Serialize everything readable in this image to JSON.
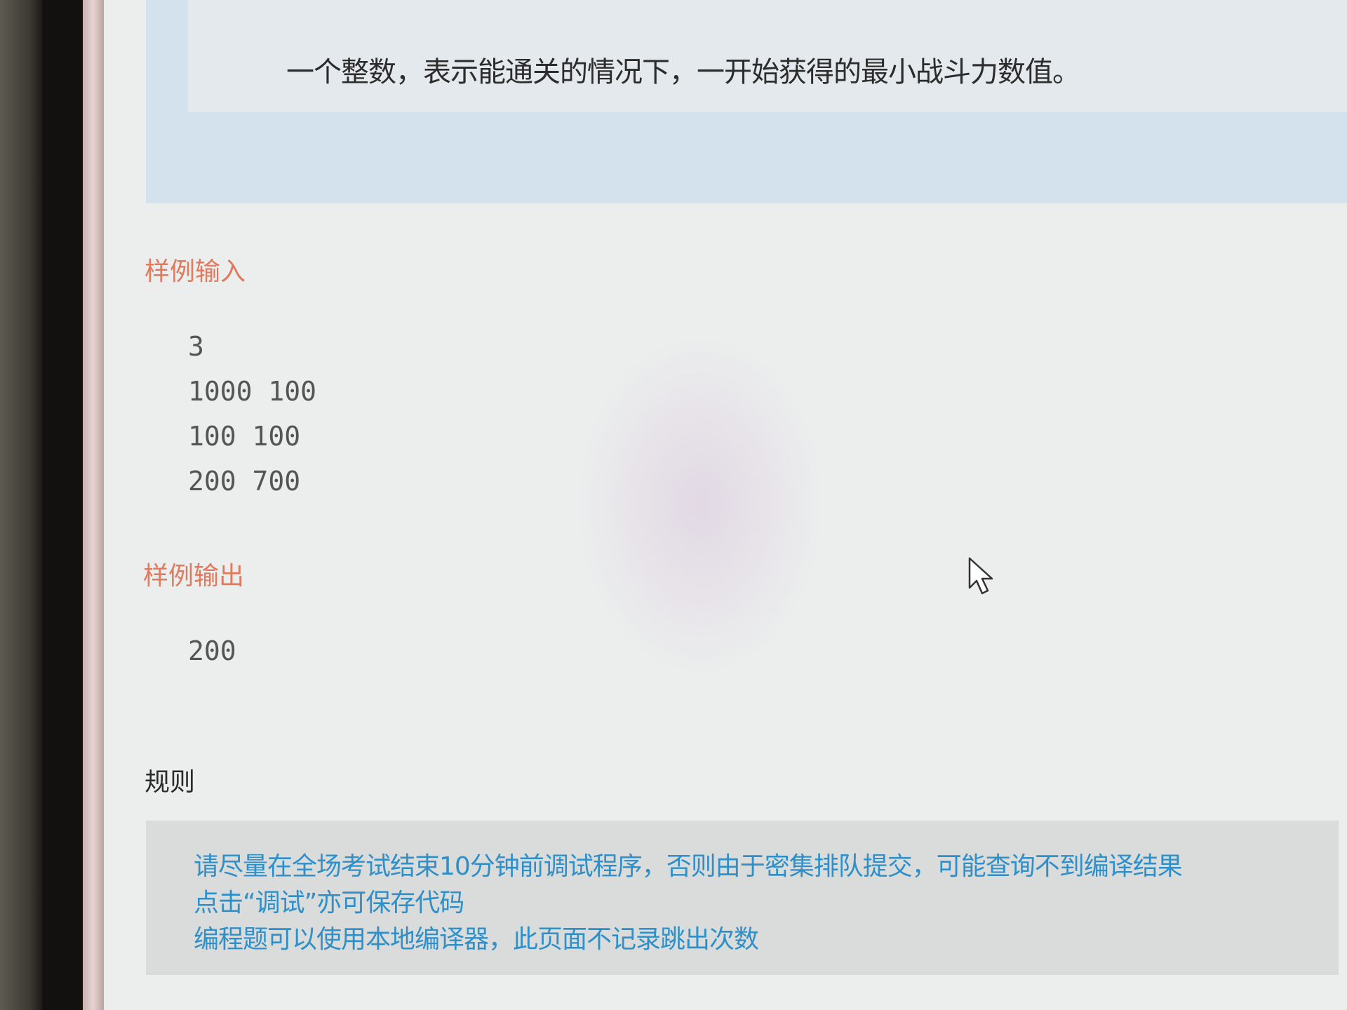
{
  "output_description": "一个整数，表示能通关的情况下，一开始获得的最小战斗力数值。",
  "sample_input": {
    "title": "样例输入",
    "lines": [
      "3",
      "1000 100",
      "100 100",
      "200 700"
    ]
  },
  "sample_output": {
    "title": "样例输出",
    "lines": [
      "200"
    ]
  },
  "rules": {
    "title": "规则",
    "lines": [
      "请尽量在全场考试结束10分钟前调试程序，否则由于密集排队提交，可能查询不到编译结果",
      "点击“调试”亦可保存代码",
      "编程题可以使用本地编译器，此页面不记录跳出次数"
    ]
  },
  "colors": {
    "heading_accent": "#e07a5e",
    "rules_text": "#2f8fc9",
    "description_bg": "#d3e2ec"
  },
  "icons": {
    "cursor": "mouse-pointer-icon"
  }
}
